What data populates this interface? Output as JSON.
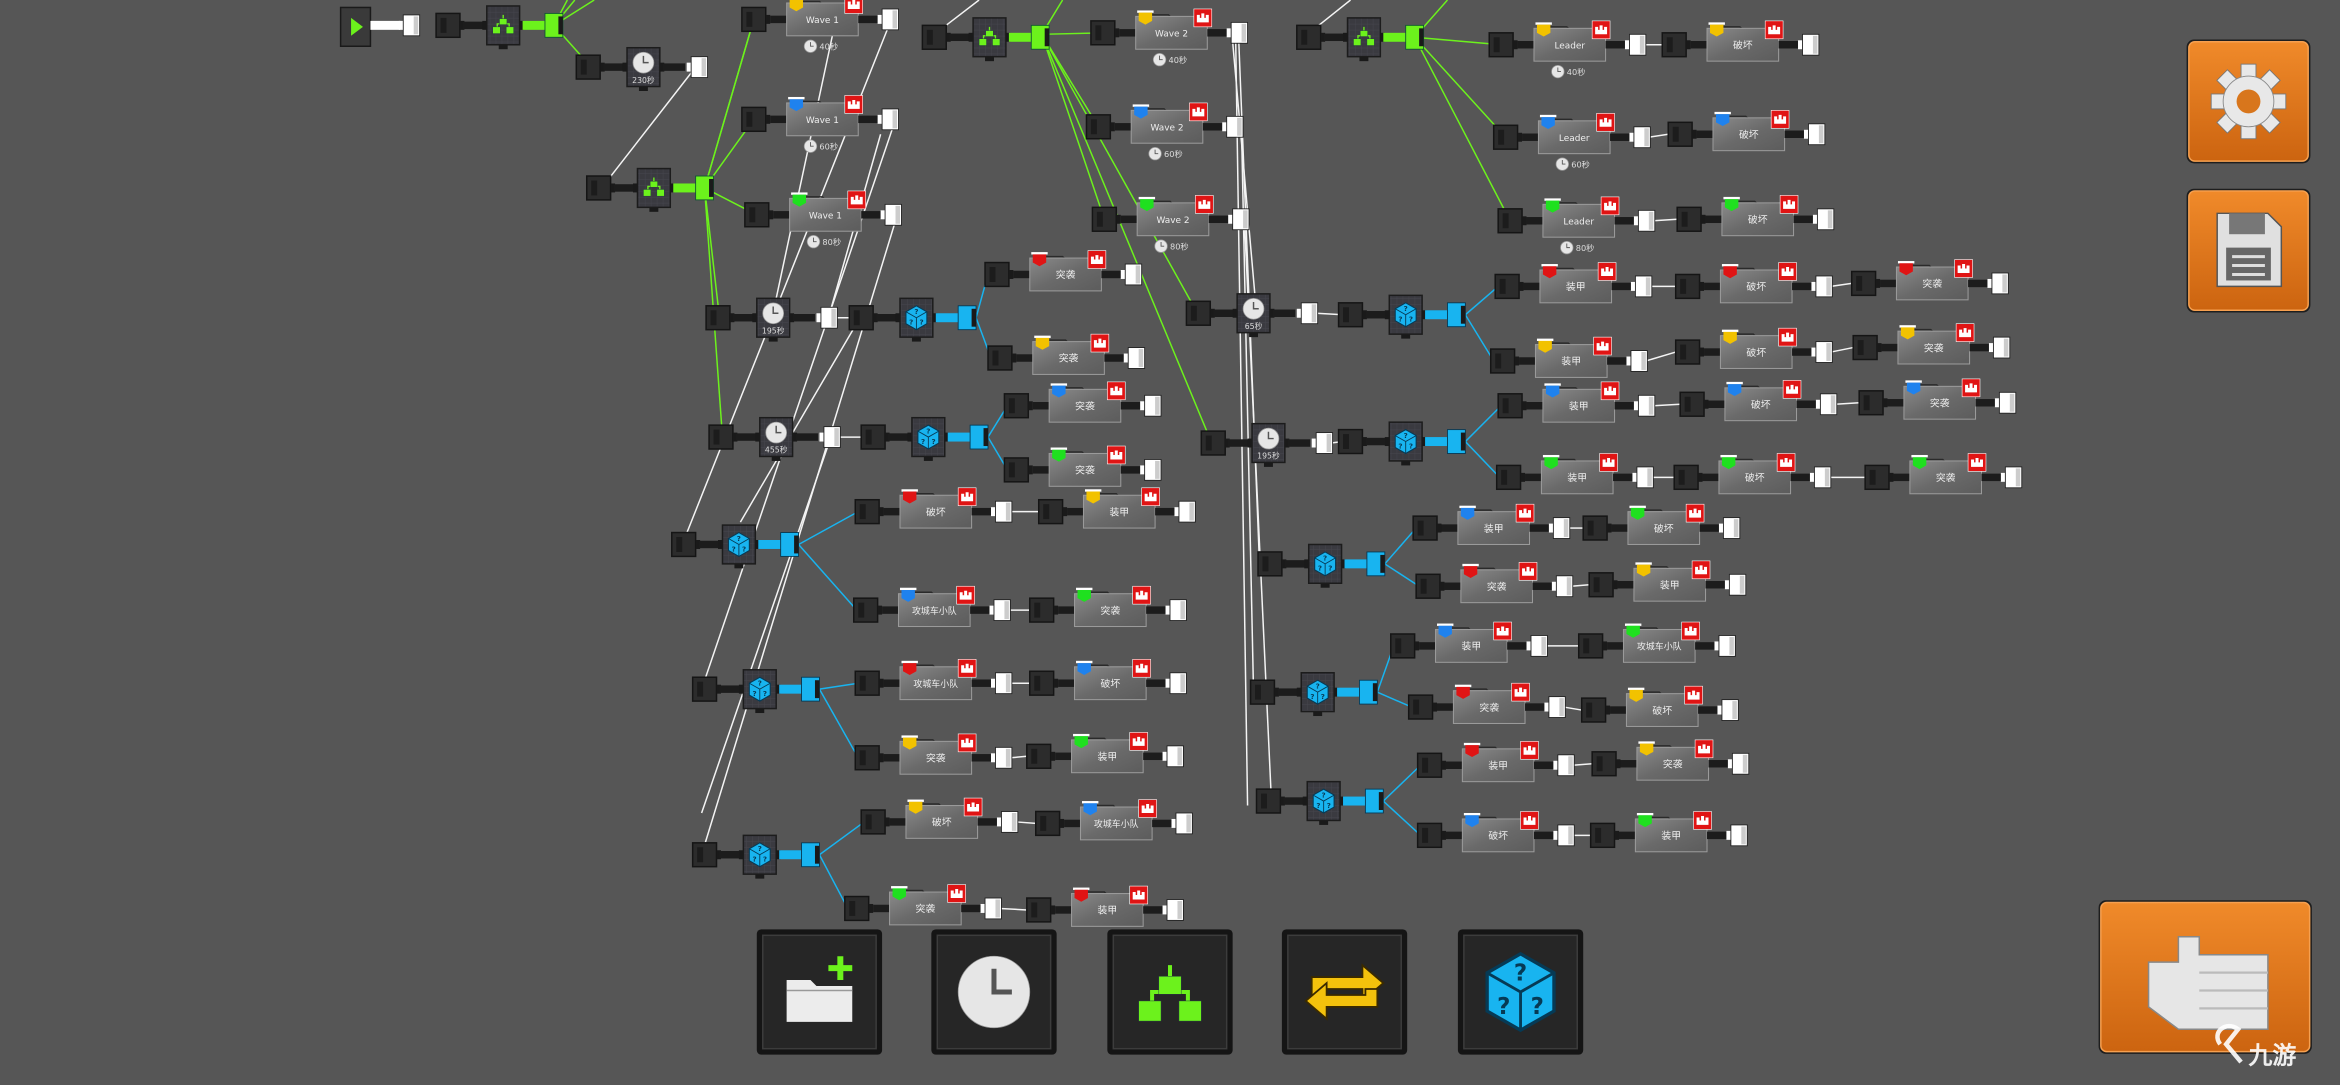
{
  "colors": {
    "background": "#565656",
    "flag_red": "#e01414",
    "flag_yellow": "#f2c200",
    "flag_blue": "#1f82ee",
    "flag_green": "#1fe01f",
    "branch_green": "#6cf21c",
    "random_cyan": "#18b4f0",
    "button_orange": "#e27a1c"
  },
  "start_node": {
    "icon": "play-icon"
  },
  "splitters": [
    {
      "icon": "branch-icon"
    },
    {
      "icon": "branch-icon"
    },
    {
      "icon": "branch-icon"
    },
    {
      "icon": "branch-icon"
    }
  ],
  "timers": [
    {
      "label": "230秒"
    },
    {
      "label": "195秒"
    },
    {
      "label": "455秒"
    },
    {
      "label": "65秒"
    },
    {
      "label": "195秒"
    }
  ],
  "random_nodes": [
    {
      "icon": "dice-icon"
    },
    {
      "icon": "dice-icon"
    },
    {
      "icon": "dice-icon"
    },
    {
      "icon": "dice-icon"
    },
    {
      "icon": "dice-icon"
    },
    {
      "icon": "dice-icon"
    },
    {
      "icon": "dice-icon"
    },
    {
      "icon": "dice-icon"
    },
    {
      "icon": "dice-icon"
    },
    {
      "icon": "dice-icon"
    }
  ],
  "cards": [
    {
      "label": "Wave 1",
      "flag": "yellow",
      "timer": "40秒"
    },
    {
      "label": "Wave 1",
      "flag": "blue",
      "timer": "60秒"
    },
    {
      "label": "Wave 1",
      "flag": "green",
      "timer": "80秒"
    },
    {
      "label": "Wave 2",
      "flag": "yellow",
      "timer": "40秒"
    },
    {
      "label": "Wave 2",
      "flag": "blue",
      "timer": "60秒"
    },
    {
      "label": "Wave 2",
      "flag": "green",
      "timer": "80秒"
    },
    {
      "label": "Leader",
      "flag": "yellow",
      "timer": "40秒"
    },
    {
      "label": "破坏",
      "flag": "yellow"
    },
    {
      "label": "Leader",
      "flag": "blue",
      "timer": "60秒"
    },
    {
      "label": "破坏",
      "flag": "blue"
    },
    {
      "label": "Leader",
      "flag": "green",
      "timer": "80秒"
    },
    {
      "label": "破坏",
      "flag": "green"
    },
    {
      "label": "突袭",
      "flag": "red"
    },
    {
      "label": "突袭",
      "flag": "yellow"
    },
    {
      "label": "突袭",
      "flag": "blue"
    },
    {
      "label": "突袭",
      "flag": "green"
    },
    {
      "label": "破坏",
      "flag": "red"
    },
    {
      "label": "装甲",
      "flag": "yellow"
    },
    {
      "label": "攻城车小队",
      "flag": "blue"
    },
    {
      "label": "突袭",
      "flag": "green"
    },
    {
      "label": "攻城车小队",
      "flag": "red"
    },
    {
      "label": "破坏",
      "flag": "blue"
    },
    {
      "label": "突袭",
      "flag": "yellow"
    },
    {
      "label": "装甲",
      "flag": "green"
    },
    {
      "label": "破坏",
      "flag": "yellow"
    },
    {
      "label": "攻城车小队",
      "flag": "blue"
    },
    {
      "label": "突袭",
      "flag": "green"
    },
    {
      "label": "装甲",
      "flag": "red"
    },
    {
      "label": "装甲",
      "flag": "red"
    },
    {
      "label": "破坏",
      "flag": "red"
    },
    {
      "label": "突袭",
      "flag": "red"
    },
    {
      "label": "装甲",
      "flag": "yellow"
    },
    {
      "label": "破坏",
      "flag": "yellow"
    },
    {
      "label": "突袭",
      "flag": "yellow"
    },
    {
      "label": "装甲",
      "flag": "blue"
    },
    {
      "label": "破坏",
      "flag": "blue"
    },
    {
      "label": "突袭",
      "flag": "blue"
    },
    {
      "label": "装甲",
      "flag": "green"
    },
    {
      "label": "破坏",
      "flag": "green"
    },
    {
      "label": "突袭",
      "flag": "green"
    },
    {
      "label": "装甲",
      "flag": "blue"
    },
    {
      "label": "破坏",
      "flag": "green"
    },
    {
      "label": "突袭",
      "flag": "red"
    },
    {
      "label": "装甲",
      "flag": "yellow"
    },
    {
      "label": "装甲",
      "flag": "blue"
    },
    {
      "label": "攻城车小队",
      "flag": "green"
    },
    {
      "label": "突袭",
      "flag": "red"
    },
    {
      "label": "破坏",
      "flag": "yellow"
    },
    {
      "label": "装甲",
      "flag": "red"
    },
    {
      "label": "突袭",
      "flag": "yellow"
    },
    {
      "label": "破坏",
      "flag": "blue"
    },
    {
      "label": "装甲",
      "flag": "green"
    }
  ],
  "side_buttons": [
    {
      "name": "settings-button",
      "icon": "gear-icon"
    },
    {
      "name": "save-button",
      "icon": "floppy-disk-icon"
    }
  ],
  "back_button": {
    "icon": "back-hand-icon"
  },
  "toolbar": {
    "buttons": [
      {
        "name": "add-folder-button",
        "icon": "add-folder-icon"
      },
      {
        "name": "add-timer-button",
        "icon": "clock-icon"
      },
      {
        "name": "add-branch-button",
        "icon": "branch-icon"
      },
      {
        "name": "add-loop-button",
        "icon": "loop-icon"
      },
      {
        "name": "add-random-button",
        "icon": "dice-icon"
      }
    ]
  },
  "watermark": {
    "text": "九游"
  }
}
